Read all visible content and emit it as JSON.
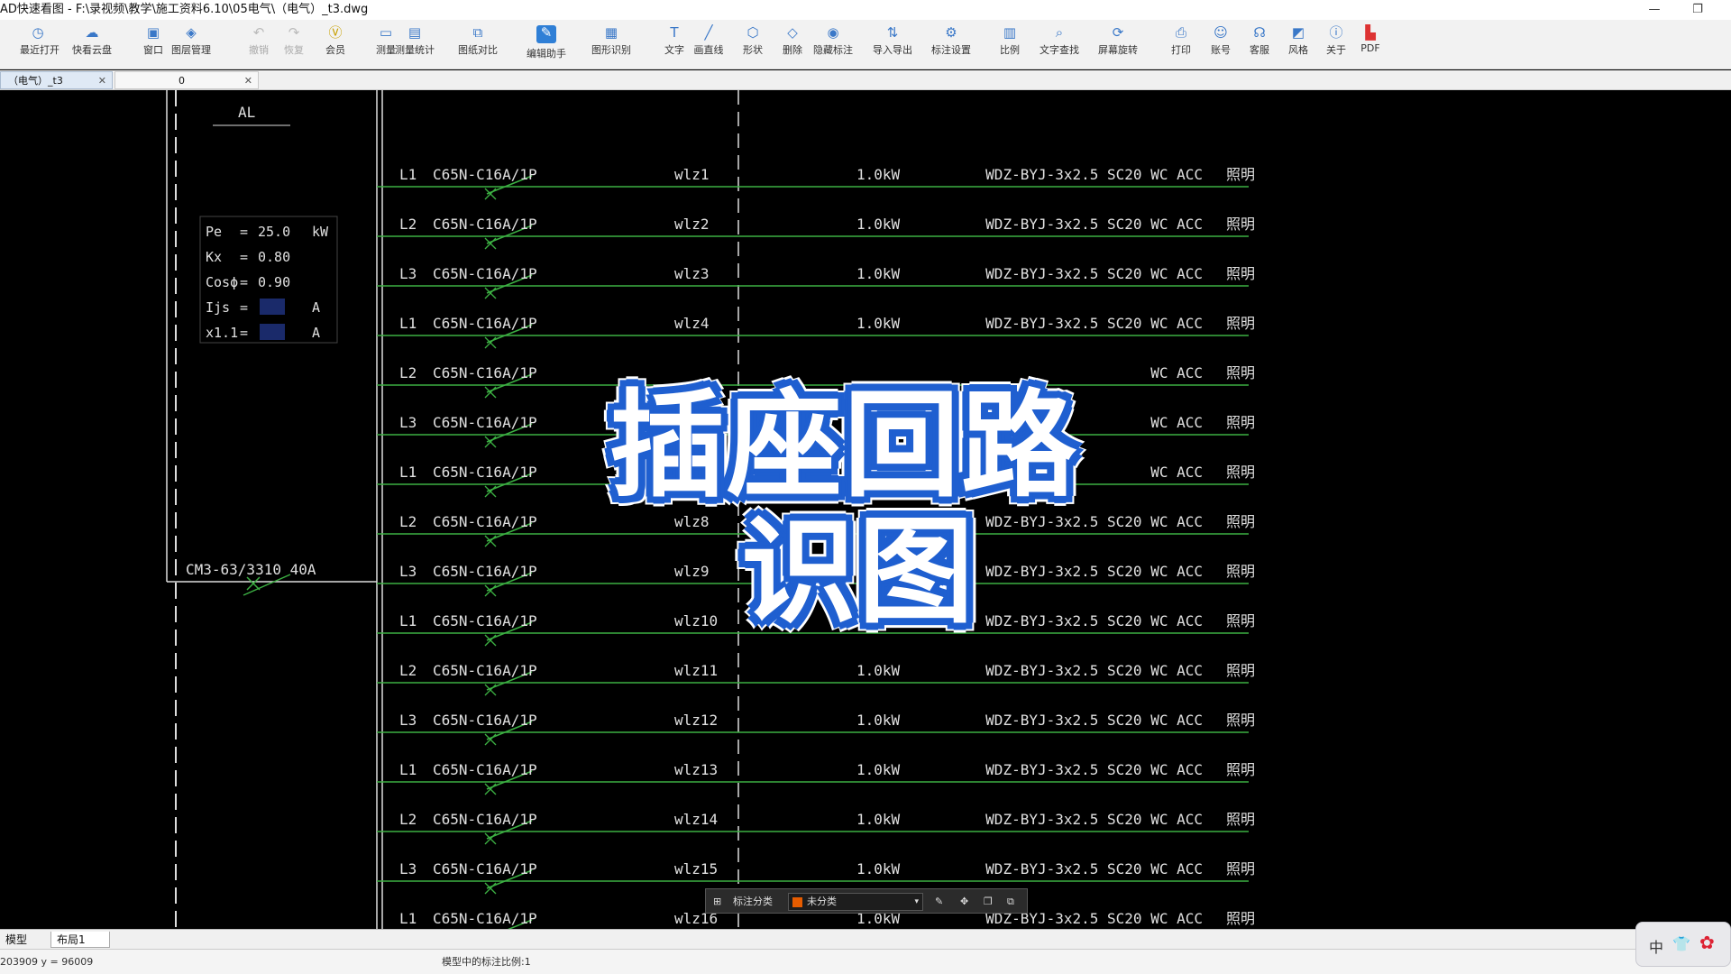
{
  "window": {
    "title": "AD快速看图 - F:\\录视频\\教学\\施工资料6.10\\05电气\\（电气）_t3.dwg",
    "min_label": "—",
    "restore_label": "❐"
  },
  "toolbar": [
    {
      "label": "最近打开",
      "icon": "clock-icon",
      "enabled": true
    },
    {
      "label": "快看云盘",
      "icon": "cloud-icon",
      "enabled": true
    },
    {
      "label": "窗口",
      "icon": "window-icon",
      "enabled": true
    },
    {
      "label": "图层管理",
      "icon": "layers-icon",
      "enabled": true
    },
    {
      "label": "撤销",
      "icon": "undo-icon",
      "enabled": false
    },
    {
      "label": "恢复",
      "icon": "redo-icon",
      "enabled": false
    },
    {
      "label": "会员",
      "icon": "vip-icon",
      "enabled": true
    },
    {
      "label": "测量",
      "icon": "ruler-icon",
      "enabled": true
    },
    {
      "label": "测量统计",
      "icon": "measure-stats-icon",
      "enabled": true
    },
    {
      "label": "图纸对比",
      "icon": "compare-icon",
      "enabled": true
    },
    {
      "label": "编辑助手",
      "icon": "edit-assistant-icon",
      "enabled": true
    },
    {
      "label": "图形识别",
      "icon": "shape-recognize-icon",
      "enabled": true
    },
    {
      "label": "文字",
      "icon": "text-icon",
      "enabled": true
    },
    {
      "label": "画直线",
      "icon": "line-icon",
      "enabled": true
    },
    {
      "label": "形状",
      "icon": "shape-icon",
      "enabled": true
    },
    {
      "label": "删除",
      "icon": "eraser-icon",
      "enabled": true
    },
    {
      "label": "隐藏标注",
      "icon": "hide-eye-icon",
      "enabled": true
    },
    {
      "label": "导入导出",
      "icon": "import-export-icon",
      "enabled": true
    },
    {
      "label": "标注设置",
      "icon": "annotation-settings-icon",
      "enabled": true
    },
    {
      "label": "比例",
      "icon": "scale-icon",
      "enabled": true
    },
    {
      "label": "文字查找",
      "icon": "text-search-icon",
      "enabled": true
    },
    {
      "label": "屏幕旋转",
      "icon": "rotate-icon",
      "enabled": true
    },
    {
      "label": "打印",
      "icon": "print-icon",
      "enabled": true
    },
    {
      "label": "账号",
      "icon": "user-icon",
      "enabled": true
    },
    {
      "label": "客服",
      "icon": "headset-icon",
      "enabled": true
    },
    {
      "label": "风格",
      "icon": "style-icon",
      "enabled": true
    },
    {
      "label": "关于",
      "icon": "info-icon",
      "enabled": true
    },
    {
      "label": "PDF",
      "icon": "pdf-icon",
      "enabled": true
    }
  ],
  "tabs": [
    {
      "label": "（电气）_t3",
      "close": "✕",
      "active": true
    },
    {
      "label": "0",
      "close": "✕",
      "active": false
    }
  ],
  "drawing": {
    "panel_label": "AL",
    "params": [
      {
        "name": "Pe",
        "eq": "=",
        "value": "25.0",
        "unit": "kW"
      },
      {
        "name": "Kx",
        "eq": "=",
        "value": "0.80",
        "unit": ""
      },
      {
        "name": "Cosϕ",
        "eq": "=",
        "value": "0.90",
        "unit": ""
      },
      {
        "name": "Ijs",
        "eq": "=",
        "value": "",
        "unit": "A"
      },
      {
        "name": "x1.1",
        "eq": "=",
        "value": "",
        "unit": "A"
      }
    ],
    "main_breaker": "CM3-63/3310 40A",
    "circuits": [
      {
        "phase": "L1",
        "breaker": "C65N-C16A/1P",
        "id": "wlz1",
        "power": "1.0kW",
        "cable": "WDZ-BYJ-3x2.5 SC20 WC ACC",
        "use": "照明"
      },
      {
        "phase": "L2",
        "breaker": "C65N-C16A/1P",
        "id": "wlz2",
        "power": "1.0kW",
        "cable": "WDZ-BYJ-3x2.5 SC20 WC ACC",
        "use": "照明"
      },
      {
        "phase": "L3",
        "breaker": "C65N-C16A/1P",
        "id": "wlz3",
        "power": "1.0kW",
        "cable": "WDZ-BYJ-3x2.5 SC20 WC ACC",
        "use": "照明"
      },
      {
        "phase": "L1",
        "breaker": "C65N-C16A/1P",
        "id": "wlz4",
        "power": "1.0kW",
        "cable": "WDZ-BYJ-3x2.5 SC20 WC ACC",
        "use": "照明"
      },
      {
        "phase": "L2",
        "breaker": "C65N-C16A/1P",
        "id": "",
        "power": "",
        "cable": "WC ACC",
        "use": "照明"
      },
      {
        "phase": "L3",
        "breaker": "C65N-C16A/1P",
        "id": "",
        "power": "",
        "cable": "WC ACC",
        "use": "照明"
      },
      {
        "phase": "L1",
        "breaker": "C65N-C16A/1P",
        "id": "",
        "power": "",
        "cable": "WC ACC",
        "use": "照明"
      },
      {
        "phase": "L2",
        "breaker": "C65N-C16A/1P",
        "id": "wlz8",
        "power": "",
        "cable": "WDZ-BYJ-3x2.5 SC20 WC ACC",
        "use": "照明"
      },
      {
        "phase": "L3",
        "breaker": "C65N-C16A/1P",
        "id": "wlz9",
        "power": "",
        "cable": "WDZ-BYJ-3x2.5 SC20 WC ACC",
        "use": "照明"
      },
      {
        "phase": "L1",
        "breaker": "C65N-C16A/1P",
        "id": "wlz10",
        "power": "",
        "cable": "WDZ-BYJ-3x2.5 SC20 WC ACC",
        "use": "照明"
      },
      {
        "phase": "L2",
        "breaker": "C65N-C16A/1P",
        "id": "wlz11",
        "power": "1.0kW",
        "cable": "WDZ-BYJ-3x2.5 SC20 WC ACC",
        "use": "照明"
      },
      {
        "phase": "L3",
        "breaker": "C65N-C16A/1P",
        "id": "wlz12",
        "power": "1.0kW",
        "cable": "WDZ-BYJ-3x2.5 SC20 WC ACC",
        "use": "照明"
      },
      {
        "phase": "L1",
        "breaker": "C65N-C16A/1P",
        "id": "wlz13",
        "power": "1.0kW",
        "cable": "WDZ-BYJ-3x2.5 SC20 WC ACC",
        "use": "照明"
      },
      {
        "phase": "L2",
        "breaker": "C65N-C16A/1P",
        "id": "wlz14",
        "power": "1.0kW",
        "cable": "WDZ-BYJ-3x2.5 SC20 WC ACC",
        "use": "照明"
      },
      {
        "phase": "L3",
        "breaker": "C65N-C16A/1P",
        "id": "wlz15",
        "power": "1.0kW",
        "cable": "WDZ-BYJ-3x2.5 SC20 WC ACC",
        "use": "照明"
      },
      {
        "phase": "L1",
        "breaker": "C65N-C16A/1P",
        "id": "wlz16",
        "power": "1.0kW",
        "cable": "WDZ-BYJ-3x2.5 SC20 WC ACC",
        "use": "照明"
      }
    ]
  },
  "overlay": {
    "line1": "插座回路",
    "line2": "识图"
  },
  "annotation_bar": {
    "category_label": "标注分类",
    "selected": "未分类"
  },
  "layout_tabs": [
    "模型",
    "布局1"
  ],
  "status": {
    "coords": "203909  y = 96009",
    "scale_text": "模型中的标注比例:1"
  },
  "ime": {
    "label": "中"
  },
  "colors": {
    "wire": "#3cb043",
    "text": "#e0e0e0",
    "overlay_fill": "#ffffff",
    "overlay_stroke": "#1f5fd0"
  }
}
